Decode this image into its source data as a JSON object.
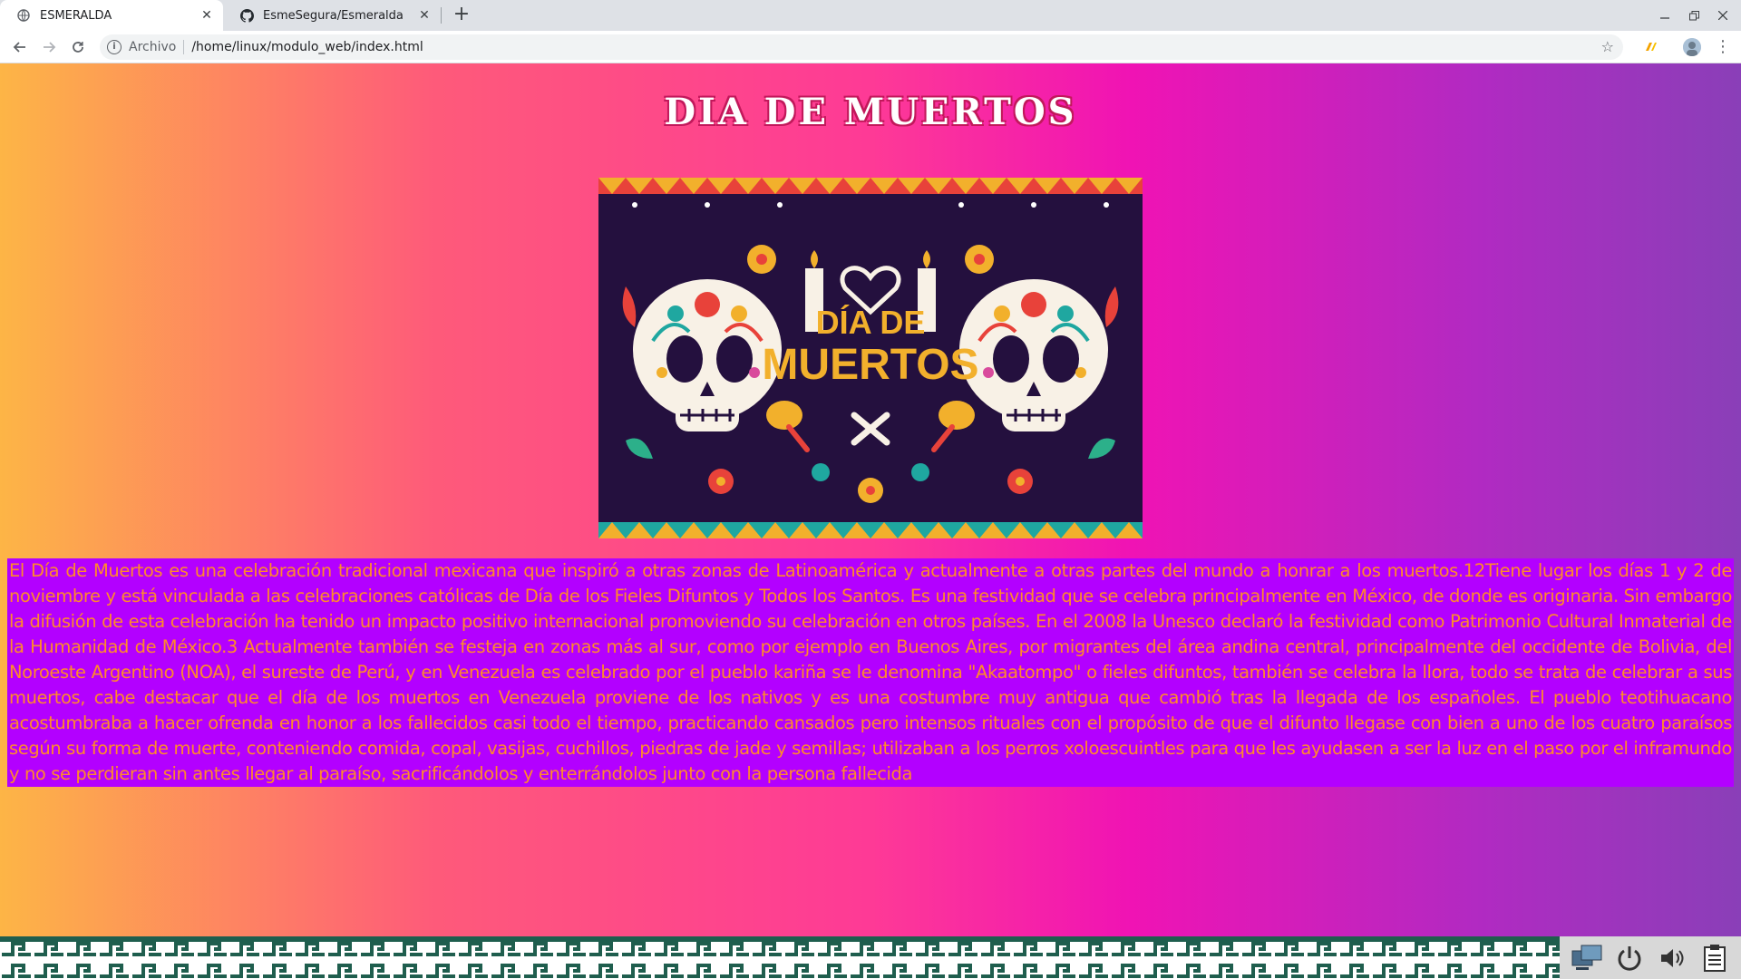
{
  "browser": {
    "tabs": [
      {
        "title": "ESMERALDA",
        "icon": "globe-icon",
        "active": true
      },
      {
        "title": "EsmeSegura/Esmeralda",
        "icon": "github-icon",
        "active": false
      }
    ],
    "address": {
      "scheme_label": "Archivo",
      "url": "/home/linux/modulo_web/index.html"
    }
  },
  "page": {
    "title": "DIA DE MUERTOS",
    "poster": {
      "line1": "DÍA DE",
      "line2": "MUERTOS"
    },
    "paragraph": "El Día de Muertos es una celebración tradicional mexicana que inspiró a otras zonas de Latinoamérica y actualmente a otras partes del mundo a honrar a los muertos.12Tiene lugar los días 1 y 2 de noviembre y está vinculada a las celebraciones católicas de Día de los Fieles Difuntos y Todos los Santos. Es una festividad que se celebra principalmente en México, de donde es originaria. Sin embargo la difusión de esta celebración ha tenido un impacto positivo internacional promoviendo su celebración en otros países. En el 2008 la Unesco declaró la festividad como Patrimonio Cultural Inmaterial de la Humanidad de México.3 Actualmente también se festeja en zonas más al sur, como por ejemplo en Buenos Aires, por migrantes del área andina central, principalmente del occidente de Bolivia, del Noroeste Argentino (NOA), el sureste de Perú, y en Venezuela es celebrado por el pueblo kariña se le denomina \"Akaatompo\" o fieles difuntos, también se celebra la llora, todo se trata de celebrar a sus muertos, cabe destacar que el día de los muertos en Venezuela proviene de los nativos y es una costumbre muy antigua que cambió tras la llegada de los españoles. El pueblo teotihuacano acostumbraba a hacer ofrenda en honor a los fallecidos casi todo el tiempo, practicando cansados pero intensos rituales con el propósito de que el difunto llegase con bien a uno de los cuatro paraísos según su forma de muerte, conteniendo comida, copal, vasijas, cuchillos, piedras de jade y semillas; utilizaban a los perros xoloescuintles para que les ayudasen a ser la luz en el paso por el inframundo y no se perdieran sin antes llegar al paraíso, sacrificándolos y enterrándolos junto con la persona fallecida"
  },
  "colors": {
    "text_block_bg": "#b300ff",
    "text_block_fg": "#ff8a2a",
    "gradient": [
      "#fdb546",
      "#fe3a96",
      "#8a3fb8"
    ],
    "taskbar_pattern": "#1f5e4e"
  },
  "tray_icons": [
    "network-icon",
    "power-icon",
    "volume-icon",
    "clipboard-icon"
  ]
}
